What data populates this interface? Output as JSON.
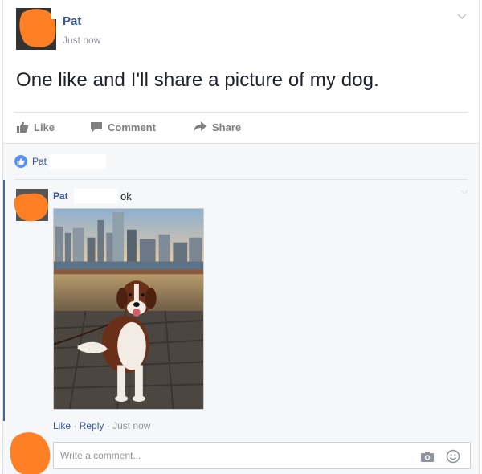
{
  "post": {
    "author": "Pat",
    "timestamp": "Just now",
    "text": "One like and I'll share a picture of my dog."
  },
  "actions": {
    "like": "Like",
    "comment": "Comment",
    "share": "Share"
  },
  "likes": {
    "names": "Pat"
  },
  "comment": {
    "author": "Pat",
    "text": "ok",
    "like_link": "Like",
    "reply_link": "Reply",
    "sep": "·",
    "timestamp": "Just now"
  },
  "composer": {
    "placeholder": "Write a comment..."
  },
  "colors": {
    "link": "#365899",
    "accent": "#4267b2",
    "avatar_redaction": "#ff7f24"
  }
}
